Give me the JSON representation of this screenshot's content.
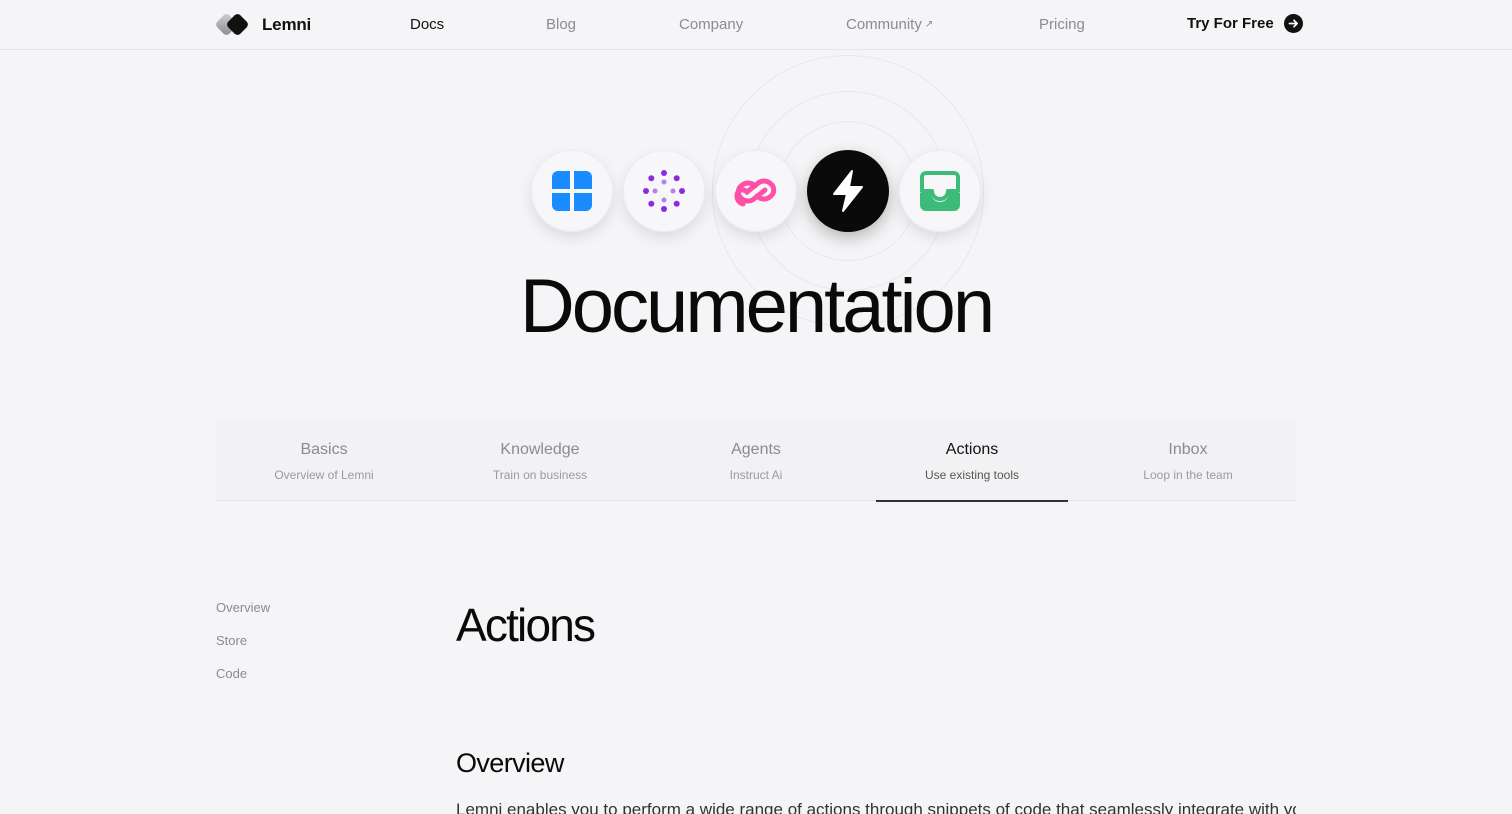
{
  "nav": {
    "brand": "Lemni",
    "links": [
      {
        "label": "Docs",
        "active": true
      },
      {
        "label": "Blog",
        "active": false
      },
      {
        "label": "Company",
        "active": false
      },
      {
        "label": "Community",
        "active": false,
        "external_icon": "arrow-up-right-icon"
      },
      {
        "label": "Pricing",
        "active": false
      }
    ],
    "cta": {
      "label": "Try For Free",
      "icon": "arrow-right-circle-icon"
    }
  },
  "hero": {
    "icons": [
      {
        "name": "grid-icon",
        "color": "#1a8cff"
      },
      {
        "name": "dots-circle-icon",
        "color": "#8a2be2"
      },
      {
        "name": "infinity-link-icon",
        "color": "#ff4fa8"
      },
      {
        "name": "lightning-icon",
        "color": "#ffffff",
        "background": "#0a0a0a"
      },
      {
        "name": "inbox-icon",
        "color": "#3dbb78"
      }
    ],
    "title": "Documentation"
  },
  "tabs": [
    {
      "title": "Basics",
      "subtitle": "Overview of Lemni",
      "active": false
    },
    {
      "title": "Knowledge",
      "subtitle": "Train on business",
      "active": false
    },
    {
      "title": "Agents",
      "subtitle": "Instruct Ai",
      "active": false
    },
    {
      "title": "Actions",
      "subtitle": "Use existing tools",
      "active": true
    },
    {
      "title": "Inbox",
      "subtitle": "Loop in the team",
      "active": false
    }
  ],
  "sidebar": {
    "items": [
      {
        "label": "Overview"
      },
      {
        "label": "Store"
      },
      {
        "label": "Code"
      }
    ]
  },
  "content": {
    "title": "Actions",
    "section_title": "Overview",
    "paragraph": "Lemni enables you to perform a wide range of actions through snippets of code that seamlessly integrate with your"
  }
}
